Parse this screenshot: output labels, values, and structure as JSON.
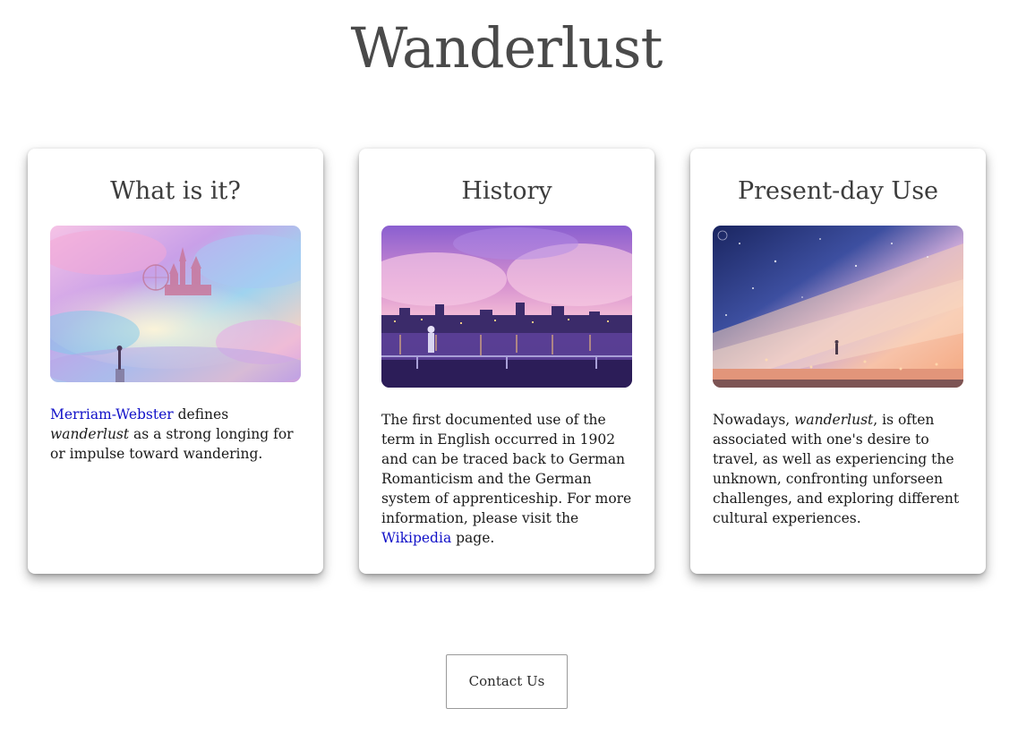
{
  "site": {
    "title": "Wanderlust"
  },
  "cards": [
    {
      "heading": "What is it?",
      "image": "fantasy-sky-castle-illustration",
      "text": {
        "link": "Merriam-Webster",
        "before_em": " defines ",
        "em": "wanderlust",
        "after_em": " as a strong longing for or impulse toward wandering."
      }
    },
    {
      "heading": "History",
      "image": "night-city-riverside-illustration",
      "text": {
        "body": "The first documented use of the term in English occurred in 1902 and can be traced back to German Romanticism and the German system of apprenticeship. For more information, please visit the ",
        "link": "Wikipedia",
        "after_link": " page."
      }
    },
    {
      "heading": "Present-day Use",
      "image": "starry-sky-field-illustration",
      "text": {
        "before_em": "Nowadays, ",
        "em": "wanderlust",
        "after_em": ", is often associated with one's desire to travel, as well as experiencing the unknown, confronting unforseen challenges, and exploring different cultural experiences."
      }
    }
  ],
  "contact": {
    "label": "Contact Us"
  },
  "colors": {
    "link": "#1010c8",
    "title": "#4a4a4a",
    "background": "#ffffff"
  }
}
